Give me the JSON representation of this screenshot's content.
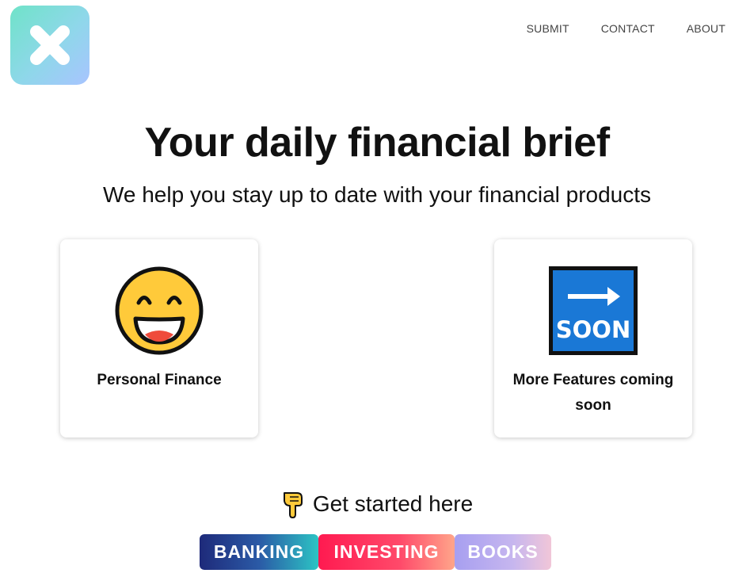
{
  "logo": {
    "icon": "close-x-icon"
  },
  "nav": {
    "items": [
      {
        "label": "SUBMIT"
      },
      {
        "label": "CONTACT"
      },
      {
        "label": "ABOUT"
      }
    ]
  },
  "hero": {
    "title": "Your daily financial brief",
    "subtitle": "We help you stay up to date with your financial products"
  },
  "cards": [
    {
      "icon": "grinning-face-icon",
      "label": "Personal Finance"
    },
    {
      "icon": "soon-arrow-icon",
      "label": "More Features coming soon",
      "icon_text": "SOON"
    }
  ],
  "cta": {
    "icon": "pointing-down-hand-icon",
    "text": "Get started here"
  },
  "buttons": [
    {
      "label": "BANKING"
    },
    {
      "label": "INVESTING"
    },
    {
      "label": "BOOKS"
    }
  ],
  "colors": {
    "soon_blue": "#1a78d6",
    "emoji_yellow": "#ffca3a"
  }
}
